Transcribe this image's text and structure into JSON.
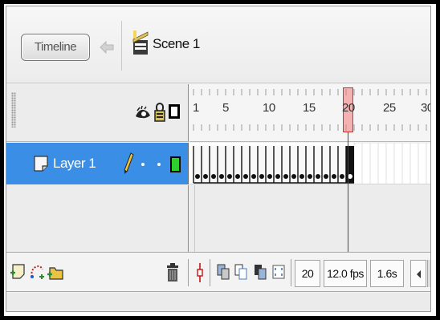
{
  "header": {
    "timeline_button": "Timeline",
    "scene_label": "Scene 1"
  },
  "ruler": {
    "labels": [
      "1",
      "5",
      "10",
      "15",
      "20",
      "25",
      "30"
    ],
    "current_frame": 20
  },
  "layers": [
    {
      "name": "Layer 1",
      "selected": true,
      "color": "#2ed02e"
    }
  ],
  "status": {
    "frame": "20",
    "fps": "12.0 fps",
    "time": "1.6s"
  },
  "colors": {
    "accent": "#3a8ee6",
    "playhead": "#cc1111",
    "layer_outline": "#2ed02e"
  },
  "icons": {
    "back": "back-arrow-icon",
    "scene": "scene-clapper-icon",
    "eye": "eye-icon",
    "lock": "lock-icon",
    "outline": "outline-square-icon",
    "layer": "layer-page-icon",
    "pencil": "pencil-icon",
    "insert_layer": "insert-layer-icon",
    "add_motion_guide": "motion-guide-icon",
    "insert_folder": "insert-folder-icon",
    "delete": "trash-icon",
    "center_frame": "center-frame-icon",
    "onion_skin": "onion-skin-icon",
    "onion_skin_outlines": "onion-skin-outlines-icon",
    "edit_multiple": "edit-multiple-frames-icon",
    "modify_markers": "modify-onion-markers-icon",
    "scroll_left": "scroll-left-icon"
  }
}
